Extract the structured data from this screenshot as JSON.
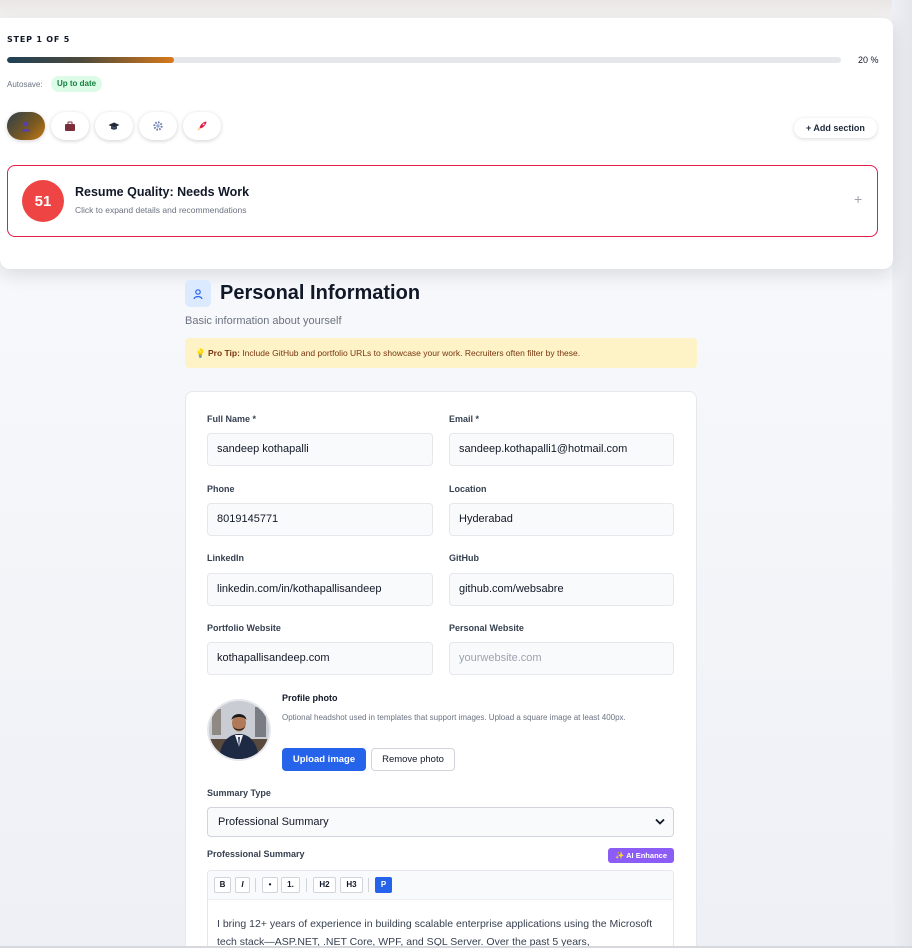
{
  "stepper": {
    "step_label": "STEP 1 OF 5",
    "progress_percent": 20,
    "progress_text": "20 %"
  },
  "autosave": {
    "label": "Autosave:",
    "status": "Up to date"
  },
  "section_tabs": [
    {
      "icon": "person-icon",
      "active": true
    },
    {
      "icon": "briefcase-icon",
      "active": false
    },
    {
      "icon": "graduation-cap-icon",
      "active": false
    },
    {
      "icon": "gear-icon",
      "active": false
    },
    {
      "icon": "rocket-icon",
      "active": false
    }
  ],
  "add_section_label": "+ Add section",
  "quality": {
    "score": "51",
    "title": "Resume Quality: Needs Work",
    "subtitle": "Click to expand details and recommendations",
    "expand_symbol": "+",
    "color": "#ef4444"
  },
  "section": {
    "title": "Personal Information",
    "subtitle": "Basic information about yourself",
    "tip_label": "Pro Tip:",
    "tip_text": "Include GitHub and portfolio URLs to showcase your work. Recruiters often filter by these."
  },
  "fields": {
    "full_name": {
      "label": "Full Name *",
      "value": "sandeep kothapalli"
    },
    "email": {
      "label": "Email *",
      "value": "sandeep.kothapalli1@hotmail.com"
    },
    "phone": {
      "label": "Phone",
      "value": "8019145771"
    },
    "location": {
      "label": "Location",
      "value": "Hyderabad"
    },
    "linkedin": {
      "label": "LinkedIn",
      "value": "linkedin.com/in/kothapallisandeep"
    },
    "github": {
      "label": "GitHub",
      "value": "github.com/websabre"
    },
    "portfolio": {
      "label": "Portfolio Website",
      "value": "kothapallisandeep.com"
    },
    "personal_website": {
      "label": "Personal Website",
      "value": "",
      "placeholder": "yourwebsite.com"
    }
  },
  "photo": {
    "title": "Profile photo",
    "help": "Optional headshot used in templates that support images. Upload a square image at least 400px.",
    "upload_label": "Upload image",
    "remove_label": "Remove photo"
  },
  "summary_type": {
    "label": "Summary Type",
    "selected": "Professional Summary"
  },
  "summary": {
    "label": "Professional Summary",
    "ai_label": "✨ AI Enhance",
    "toolbar": {
      "bold": "B",
      "italic": "I",
      "bullet": "•",
      "numbered": "1.",
      "h2": "H2",
      "h3": "H3",
      "paragraph": "P"
    },
    "text": "I bring 12+ years of experience in building scalable enterprise applications using the Microsoft tech stack—ASP.NET, .NET Core, WPF, and SQL Server. Over the past 5 years,"
  },
  "colors": {
    "accent": "#2563eb",
    "ai": "#8b5cf6",
    "tip_bg": "#fef3c7",
    "success_bg": "#dcfce7"
  }
}
